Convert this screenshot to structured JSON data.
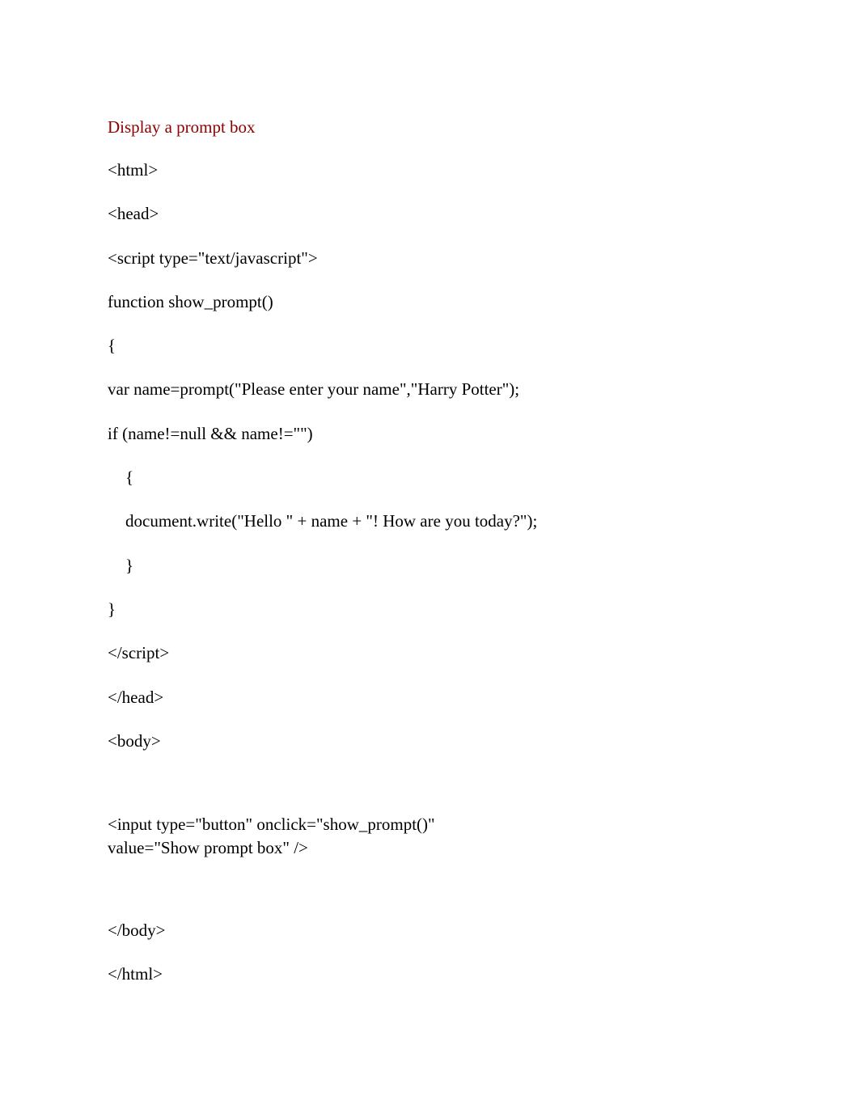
{
  "title": "Display a prompt box",
  "lines": {
    "l1": "<html>",
    "l2": "<head>",
    "l3": "<script type=\"text/javascript\">",
    "l4": "function show_prompt()",
    "l5": "{",
    "l6": "var name=prompt(\"Please enter your name\",\"Harry Potter\");",
    "l7": "if (name!=null && name!=\"\")",
    "l8": "{",
    "l9": "document.write(\"Hello \" + name + \"! How are you today?\");",
    "l10": "}",
    "l11": "}",
    "l12": "</script>",
    "l13": "</head>",
    "l14": "<body>",
    "l15a": "<input type=\"button\" onclick=\"show_prompt()\"",
    "l15b": "value=\"Show prompt box\" />",
    "l16": "</body>",
    "l17": "</html>"
  }
}
